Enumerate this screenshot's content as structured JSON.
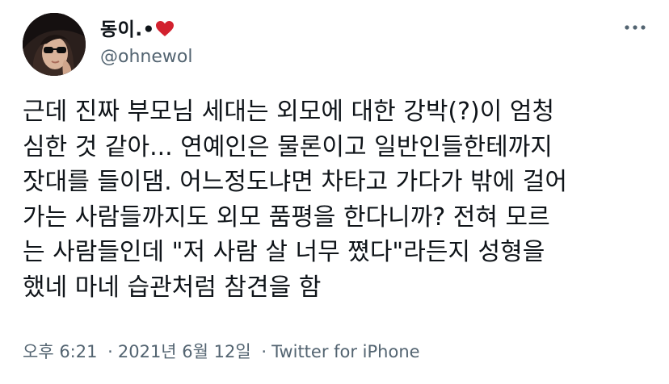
{
  "author": {
    "display_name": "동이.•",
    "handle": "@ohnewol",
    "avatar_icon": "profile-photo-woman-sunglasses",
    "heart_icon": "red-heart",
    "heart_color": "#d2212e"
  },
  "tweet": {
    "lines": [
      "근데 진짜 부모님 세대는 외모에 대한 강박(?)이 엄청",
      "심한 것 같아... 연예인은 물론이고 일반인들한테까지",
      "잣대를 들이댐. 어느정도냐면 차타고 가다가 밖에 걸어",
      "가는 사람들까지도 외모 품평을 한다니까? 전혀 모르",
      "는 사람들인데 \"저 사람 살 너무 쪘다\"라든지 성형을",
      "했네 마네 습관처럼 참견을 함"
    ]
  },
  "meta": {
    "time": "오후 6:21",
    "separator": "·",
    "date": "2021년 6월 12일",
    "source": "Twitter for iPhone"
  },
  "more_icon": "more-dots-icon",
  "colors": {
    "text": "#0f1419",
    "secondary": "#536471"
  }
}
